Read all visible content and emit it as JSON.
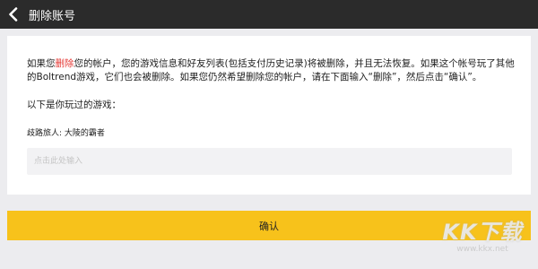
{
  "header": {
    "title": "删除账号",
    "back_icon": "chevron-left-icon"
  },
  "warning": {
    "before": "如果您",
    "highlight": "删除",
    "after": "您的帐户，您的游戏信息和好友列表(包括支付历史记录)将被删除，并且无法恢复。如果这个帐号玩了其他的Boltrend游戏，它们也会被删除。如果您仍然希望删除您的帐户，请在下面输入“删除”，然后点击“确认”。",
    "highlight_color": "#e53935"
  },
  "games": {
    "heading": "以下是你玩过的游戏：",
    "items": [
      "歧路旅人: 大陵的霸者"
    ]
  },
  "input": {
    "value": "",
    "placeholder": "点击此处输入"
  },
  "confirm_button": {
    "label": "确认",
    "color": "#f7c21b"
  },
  "watermark": {
    "logo": "KK下载",
    "url": "www.kkx.net"
  },
  "colors": {
    "topbar": "#2b2b2b",
    "background": "#ececef",
    "card": "#ffffff"
  }
}
